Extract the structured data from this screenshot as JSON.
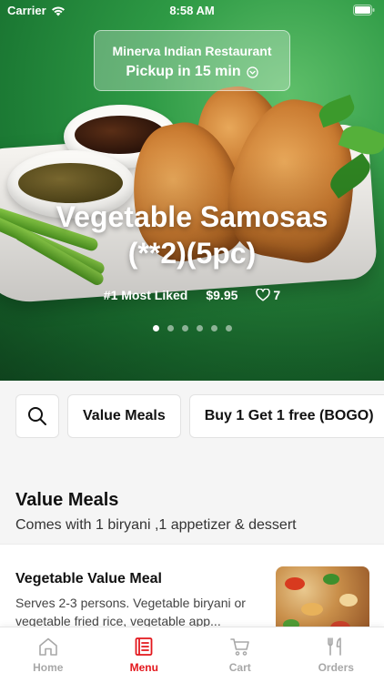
{
  "status_bar": {
    "carrier": "Carrier",
    "time": "8:58 AM"
  },
  "restaurant": {
    "name": "Minerva Indian Restaurant",
    "pickup": "Pickup in 15 min"
  },
  "featured": {
    "title_line1": "Vegetable Samosas",
    "title_line2": "(**2)(5pc)",
    "rank": "#1 Most Liked",
    "price": "$9.95",
    "likes": "7",
    "slides": 6,
    "active_slide": 1
  },
  "categories": [
    "Value Meals",
    "Buy 1 Get 1 free (BOGO)"
  ],
  "section": {
    "title": "Value Meals",
    "subtitle": "Comes with 1 biryani ,1 appetizer & dessert",
    "items": [
      {
        "name": "Vegetable Value Meal",
        "description": "Serves 2-3 persons. Vegetable biryani or vegetable fried rice, vegetable app..."
      }
    ]
  },
  "tabs": [
    {
      "label": "Home",
      "icon": "home-icon",
      "active": false
    },
    {
      "label": "Menu",
      "icon": "menu-icon",
      "active": true
    },
    {
      "label": "Cart",
      "icon": "cart-icon",
      "active": false
    },
    {
      "label": "Orders",
      "icon": "orders-icon",
      "active": false
    }
  ],
  "colors": {
    "accent": "#e3171d",
    "hero_bg": "#2e9a45"
  }
}
